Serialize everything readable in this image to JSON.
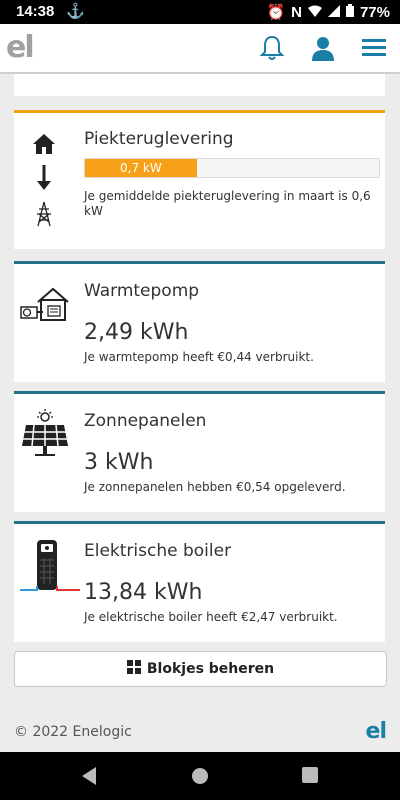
{
  "status_bar": {
    "time": "14:38",
    "battery": "77%"
  },
  "header": {
    "logo": "el"
  },
  "cards": [
    {
      "title": "Piekteruglevering",
      "progress_label": "0,7 kW",
      "progress_fraction": 0.38,
      "description": "Je gemiddelde piekteruglevering in maart is 0,6 kW"
    },
    {
      "title": "Warmtepomp",
      "value": "2,49 kWh",
      "description": "Je warmtepomp heeft €0,44 verbruikt."
    },
    {
      "title": "Zonnepanelen",
      "value": "3 kWh",
      "description": "Je zonnepanelen hebben €0,54 opgeleverd."
    },
    {
      "title": "Elektrische boiler",
      "value": "13,84 kWh",
      "description": "Je elektrische boiler heeft €2,47 verbruikt."
    }
  ],
  "manage_button": {
    "label": "Blokjes beheren"
  },
  "footer": {
    "copyright": "© 2022 Enelogic",
    "logo": "el"
  },
  "colors": {
    "accent_orange": "#f0a30a",
    "accent_blue": "#23728a",
    "brand": "#1a7fa6"
  }
}
